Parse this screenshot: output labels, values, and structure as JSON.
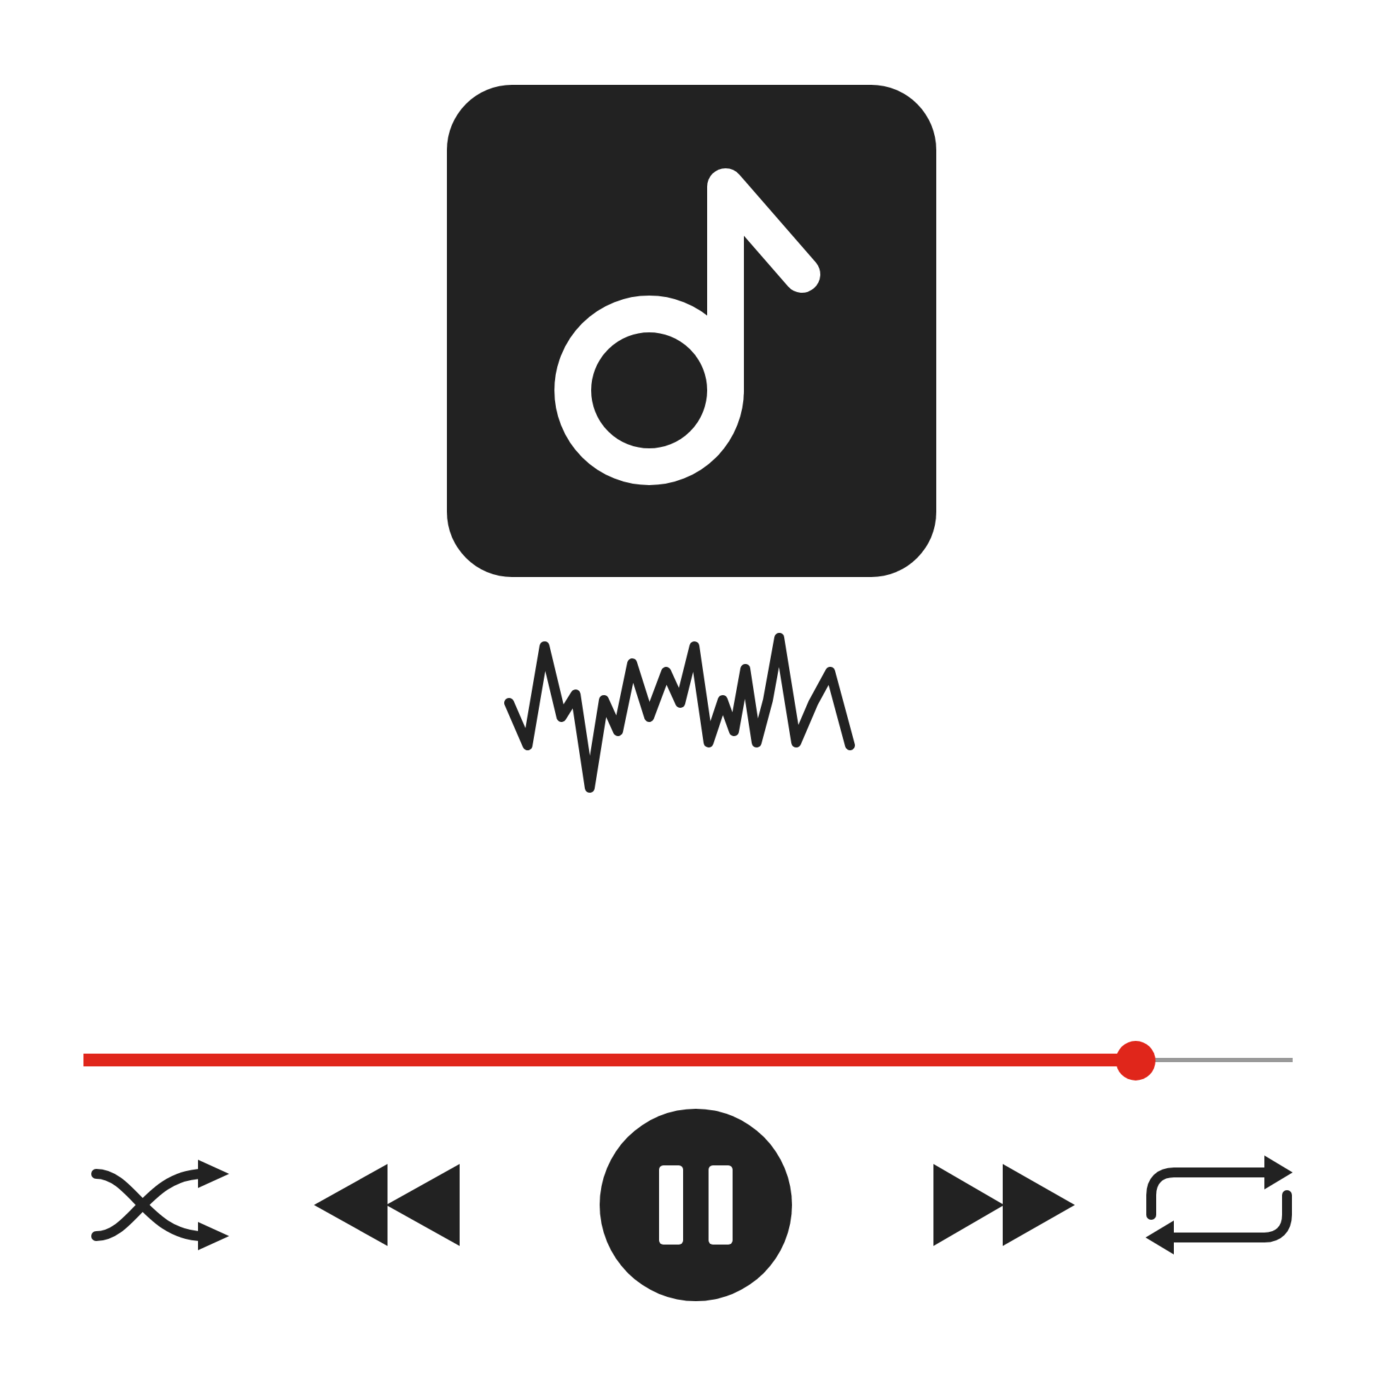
{
  "player": {
    "playing": true,
    "progress": {
      "level": 0.87
    },
    "controls": [
      {
        "kind": "shuffle"
      },
      {
        "kind": "rewind"
      },
      {
        "kind": "play_pause"
      },
      {
        "kind": "fast_forward"
      },
      {
        "kind": "repeat"
      }
    ]
  }
}
